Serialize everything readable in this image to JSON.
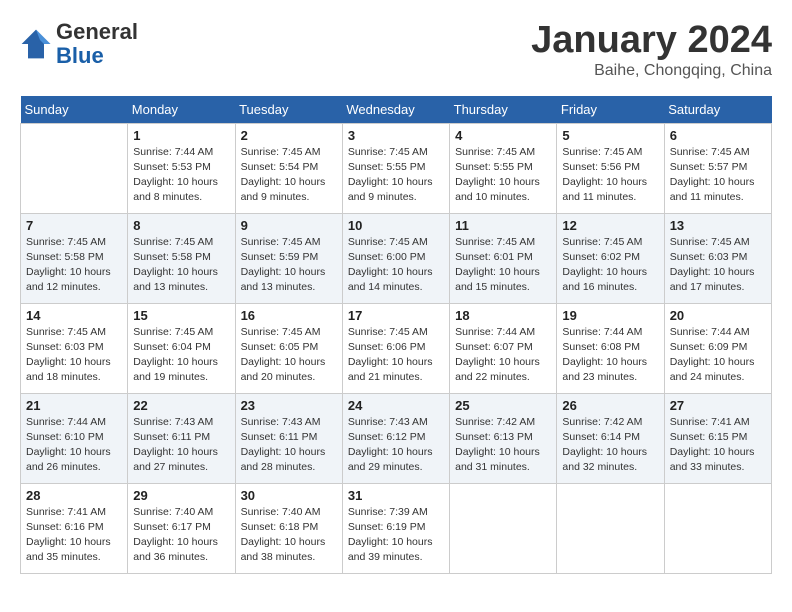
{
  "header": {
    "logo_line1": "General",
    "logo_line2": "Blue",
    "month_title": "January 2024",
    "location": "Baihe, Chongqing, China"
  },
  "days_of_week": [
    "Sunday",
    "Monday",
    "Tuesday",
    "Wednesday",
    "Thursday",
    "Friday",
    "Saturday"
  ],
  "weeks": [
    [
      {
        "day": "",
        "sunrise": "",
        "sunset": "",
        "daylight": ""
      },
      {
        "day": "1",
        "sunrise": "Sunrise: 7:44 AM",
        "sunset": "Sunset: 5:53 PM",
        "daylight": "Daylight: 10 hours and 8 minutes."
      },
      {
        "day": "2",
        "sunrise": "Sunrise: 7:45 AM",
        "sunset": "Sunset: 5:54 PM",
        "daylight": "Daylight: 10 hours and 9 minutes."
      },
      {
        "day": "3",
        "sunrise": "Sunrise: 7:45 AM",
        "sunset": "Sunset: 5:55 PM",
        "daylight": "Daylight: 10 hours and 9 minutes."
      },
      {
        "day": "4",
        "sunrise": "Sunrise: 7:45 AM",
        "sunset": "Sunset: 5:55 PM",
        "daylight": "Daylight: 10 hours and 10 minutes."
      },
      {
        "day": "5",
        "sunrise": "Sunrise: 7:45 AM",
        "sunset": "Sunset: 5:56 PM",
        "daylight": "Daylight: 10 hours and 11 minutes."
      },
      {
        "day": "6",
        "sunrise": "Sunrise: 7:45 AM",
        "sunset": "Sunset: 5:57 PM",
        "daylight": "Daylight: 10 hours and 11 minutes."
      }
    ],
    [
      {
        "day": "7",
        "sunrise": "Sunrise: 7:45 AM",
        "sunset": "Sunset: 5:58 PM",
        "daylight": "Daylight: 10 hours and 12 minutes."
      },
      {
        "day": "8",
        "sunrise": "Sunrise: 7:45 AM",
        "sunset": "Sunset: 5:58 PM",
        "daylight": "Daylight: 10 hours and 13 minutes."
      },
      {
        "day": "9",
        "sunrise": "Sunrise: 7:45 AM",
        "sunset": "Sunset: 5:59 PM",
        "daylight": "Daylight: 10 hours and 13 minutes."
      },
      {
        "day": "10",
        "sunrise": "Sunrise: 7:45 AM",
        "sunset": "Sunset: 6:00 PM",
        "daylight": "Daylight: 10 hours and 14 minutes."
      },
      {
        "day": "11",
        "sunrise": "Sunrise: 7:45 AM",
        "sunset": "Sunset: 6:01 PM",
        "daylight": "Daylight: 10 hours and 15 minutes."
      },
      {
        "day": "12",
        "sunrise": "Sunrise: 7:45 AM",
        "sunset": "Sunset: 6:02 PM",
        "daylight": "Daylight: 10 hours and 16 minutes."
      },
      {
        "day": "13",
        "sunrise": "Sunrise: 7:45 AM",
        "sunset": "Sunset: 6:03 PM",
        "daylight": "Daylight: 10 hours and 17 minutes."
      }
    ],
    [
      {
        "day": "14",
        "sunrise": "Sunrise: 7:45 AM",
        "sunset": "Sunset: 6:03 PM",
        "daylight": "Daylight: 10 hours and 18 minutes."
      },
      {
        "day": "15",
        "sunrise": "Sunrise: 7:45 AM",
        "sunset": "Sunset: 6:04 PM",
        "daylight": "Daylight: 10 hours and 19 minutes."
      },
      {
        "day": "16",
        "sunrise": "Sunrise: 7:45 AM",
        "sunset": "Sunset: 6:05 PM",
        "daylight": "Daylight: 10 hours and 20 minutes."
      },
      {
        "day": "17",
        "sunrise": "Sunrise: 7:45 AM",
        "sunset": "Sunset: 6:06 PM",
        "daylight": "Daylight: 10 hours and 21 minutes."
      },
      {
        "day": "18",
        "sunrise": "Sunrise: 7:44 AM",
        "sunset": "Sunset: 6:07 PM",
        "daylight": "Daylight: 10 hours and 22 minutes."
      },
      {
        "day": "19",
        "sunrise": "Sunrise: 7:44 AM",
        "sunset": "Sunset: 6:08 PM",
        "daylight": "Daylight: 10 hours and 23 minutes."
      },
      {
        "day": "20",
        "sunrise": "Sunrise: 7:44 AM",
        "sunset": "Sunset: 6:09 PM",
        "daylight": "Daylight: 10 hours and 24 minutes."
      }
    ],
    [
      {
        "day": "21",
        "sunrise": "Sunrise: 7:44 AM",
        "sunset": "Sunset: 6:10 PM",
        "daylight": "Daylight: 10 hours and 26 minutes."
      },
      {
        "day": "22",
        "sunrise": "Sunrise: 7:43 AM",
        "sunset": "Sunset: 6:11 PM",
        "daylight": "Daylight: 10 hours and 27 minutes."
      },
      {
        "day": "23",
        "sunrise": "Sunrise: 7:43 AM",
        "sunset": "Sunset: 6:11 PM",
        "daylight": "Daylight: 10 hours and 28 minutes."
      },
      {
        "day": "24",
        "sunrise": "Sunrise: 7:43 AM",
        "sunset": "Sunset: 6:12 PM",
        "daylight": "Daylight: 10 hours and 29 minutes."
      },
      {
        "day": "25",
        "sunrise": "Sunrise: 7:42 AM",
        "sunset": "Sunset: 6:13 PM",
        "daylight": "Daylight: 10 hours and 31 minutes."
      },
      {
        "day": "26",
        "sunrise": "Sunrise: 7:42 AM",
        "sunset": "Sunset: 6:14 PM",
        "daylight": "Daylight: 10 hours and 32 minutes."
      },
      {
        "day": "27",
        "sunrise": "Sunrise: 7:41 AM",
        "sunset": "Sunset: 6:15 PM",
        "daylight": "Daylight: 10 hours and 33 minutes."
      }
    ],
    [
      {
        "day": "28",
        "sunrise": "Sunrise: 7:41 AM",
        "sunset": "Sunset: 6:16 PM",
        "daylight": "Daylight: 10 hours and 35 minutes."
      },
      {
        "day": "29",
        "sunrise": "Sunrise: 7:40 AM",
        "sunset": "Sunset: 6:17 PM",
        "daylight": "Daylight: 10 hours and 36 minutes."
      },
      {
        "day": "30",
        "sunrise": "Sunrise: 7:40 AM",
        "sunset": "Sunset: 6:18 PM",
        "daylight": "Daylight: 10 hours and 38 minutes."
      },
      {
        "day": "31",
        "sunrise": "Sunrise: 7:39 AM",
        "sunset": "Sunset: 6:19 PM",
        "daylight": "Daylight: 10 hours and 39 minutes."
      },
      {
        "day": "",
        "sunrise": "",
        "sunset": "",
        "daylight": ""
      },
      {
        "day": "",
        "sunrise": "",
        "sunset": "",
        "daylight": ""
      },
      {
        "day": "",
        "sunrise": "",
        "sunset": "",
        "daylight": ""
      }
    ]
  ]
}
